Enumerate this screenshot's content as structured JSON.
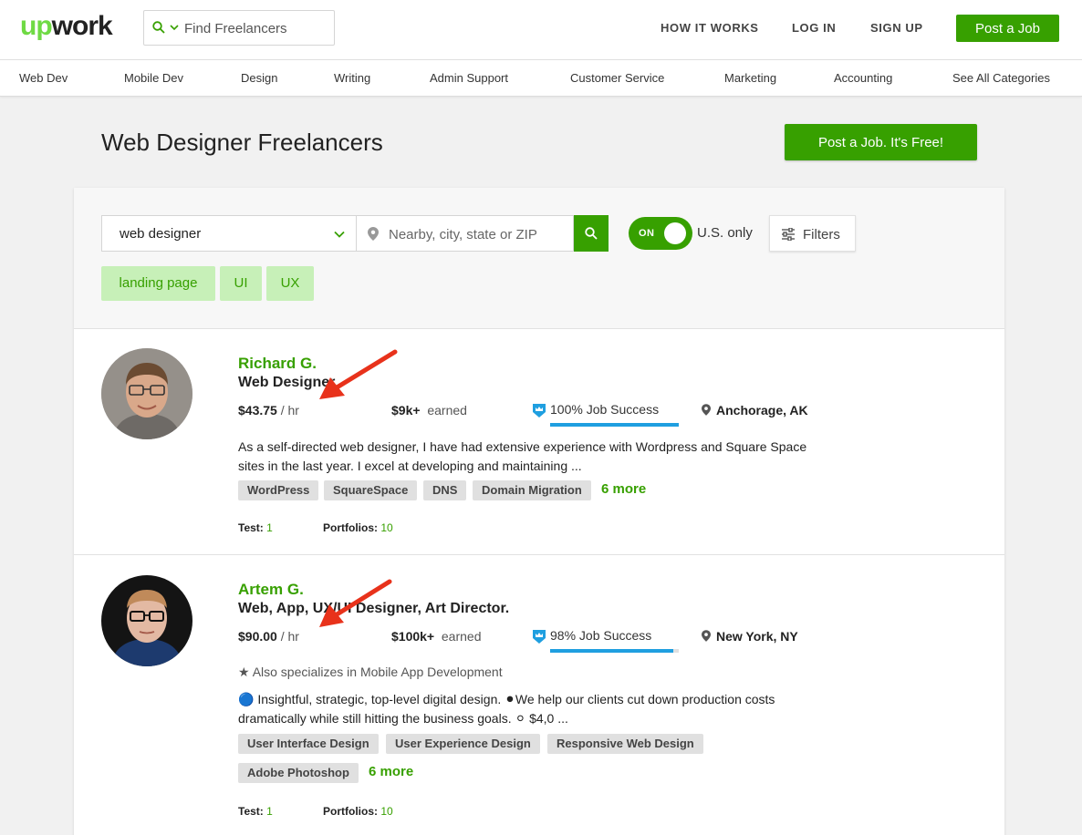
{
  "header": {
    "logo_up": "up",
    "logo_work": "work",
    "search_placeholder": "Find Freelancers",
    "nav": [
      "HOW IT WORKS",
      "LOG IN",
      "SIGN UP"
    ],
    "post_job_label": "Post a Job"
  },
  "categories": [
    "Web Dev",
    "Mobile Dev",
    "Design",
    "Writing",
    "Admin Support",
    "Customer Service",
    "Marketing",
    "Accounting",
    "See All Categories"
  ],
  "page": {
    "title": "Web Designer Freelancers",
    "post_free_label": "Post a Job. It's Free!"
  },
  "search": {
    "query": "web designer",
    "location_placeholder": "Nearby, city, state or ZIP",
    "toggle_label": "ON",
    "us_only_label": "U.S. only",
    "filters_label": "Filters",
    "chips": [
      "landing page",
      "UI",
      "UX"
    ]
  },
  "freelancers": [
    {
      "name": "Richard G.",
      "title": "Web Designer",
      "rate": "$43.75",
      "rate_unit": "/ hr",
      "earned_amount": "$9k+",
      "earned_label": "earned",
      "job_success": "100% Job Success",
      "job_success_pct": 100,
      "location": "Anchorage, AK",
      "description": "As a self-directed web designer, I have had extensive experience with Wordpress and Square Space sites in the last year. I excel at developing and maintaining ...",
      "skills": [
        "WordPress",
        "SquareSpace",
        "DNS",
        "Domain Migration"
      ],
      "more_label": "6 more",
      "test_label": "Test:",
      "test_count": "1",
      "portfolio_label": "Portfolios:",
      "portfolio_count": "10"
    },
    {
      "name": "Artem G.",
      "title": "Web, App, UX/UI Designer, Art Director.",
      "rate": "$90.00",
      "rate_unit": "/ hr",
      "earned_amount": "$100k+",
      "earned_label": "earned",
      "job_success": "98% Job Success",
      "job_success_pct": 96,
      "location": "New York, NY",
      "specializes": "Also specializes in Mobile App Development",
      "description": "🔵 Insightful, strategic, top-level digital design. ⚫We help our clients cut down production costs dramatically while still hitting the business goals. ⚪ $4,0 ...",
      "skills": [
        "User Interface Design",
        "User Experience Design",
        "Responsive Web Design",
        "Adobe Photoshop"
      ],
      "more_label": "6 more",
      "test_label": "Test:",
      "test_count": "1",
      "portfolio_label": "Portfolios:",
      "portfolio_count": "10"
    }
  ],
  "colors": {
    "brand_green": "#37a000",
    "logo_green": "#6fda44",
    "chip_bg": "#c7f0b8",
    "jss_blue": "#1f9fe0",
    "annotation_red": "#e8321b"
  }
}
